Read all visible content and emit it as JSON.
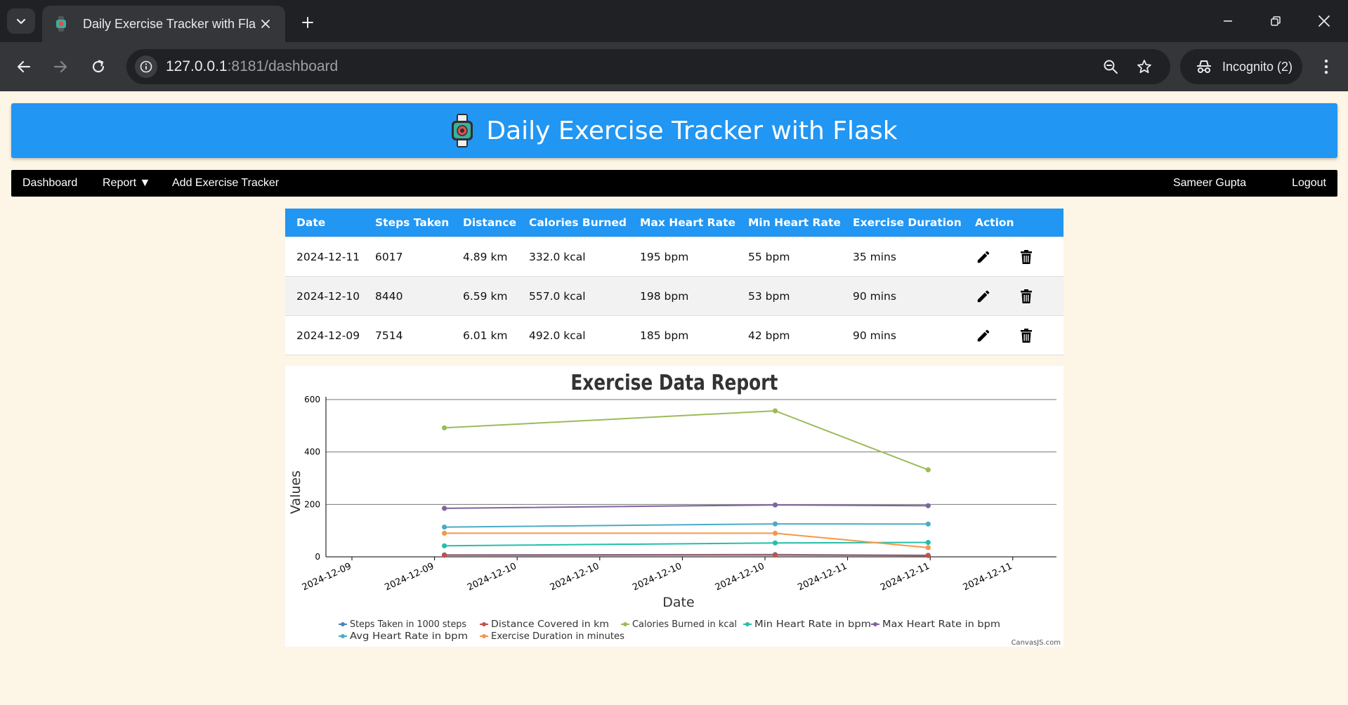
{
  "browser": {
    "tab_title": "Daily Exercise Tracker with Flask",
    "url_host": "127.0.0.1",
    "url_path": ":8181/dashboard",
    "incognito_label": "Incognito (2)"
  },
  "header": {
    "title": "Daily Exercise Tracker with Flask"
  },
  "nav": {
    "dashboard": "Dashboard",
    "report": "Report ▼",
    "add_tracker": "Add Exercise Tracker",
    "user": "Sameer Gupta",
    "logout": "Logout"
  },
  "table": {
    "headers": [
      "Date",
      "Steps Taken",
      "Distance",
      "Calories Burned",
      "Max Heart Rate",
      "Min Heart Rate",
      "Exercise Duration",
      "Action"
    ],
    "rows": [
      [
        "2024-12-11",
        "6017",
        "4.89 km",
        "332.0 kcal",
        "195 bpm",
        "55 bpm",
        "35 mins"
      ],
      [
        "2024-12-10",
        "8440",
        "6.59 km",
        "557.0 kcal",
        "198 bpm",
        "53 bpm",
        "90 mins"
      ],
      [
        "2024-12-09",
        "7514",
        "6.01 km",
        "492.0 kcal",
        "185 bpm",
        "42 bpm",
        "90 mins"
      ]
    ]
  },
  "colors": {
    "accent": "#2196f3",
    "navbar": "#000000",
    "page_bg": "#fdf5e6"
  },
  "chart_data": {
    "type": "line",
    "title": "Exercise Data Report",
    "xlabel": "Date",
    "ylabel": "Values",
    "ylim": [
      0,
      600
    ],
    "yticks": [
      0,
      200,
      400,
      600
    ],
    "xlim": [
      "2024-12-08 12:00",
      "2024-12-11 14:00"
    ],
    "x_tick_labels": [
      "2024-12-09",
      "2024-12-09",
      "2024-12-10",
      "2024-12-10",
      "2024-12-10",
      "2024-12-10",
      "2024-12-11",
      "2024-12-11",
      "2024-12-11"
    ],
    "x": [
      "2024-12-09 00:00",
      "2024-12-10 09:30",
      "2024-12-11 01:00"
    ],
    "grid": true,
    "legend_position": "bottom-center",
    "credit": "CanvasJS.com",
    "series": [
      {
        "name": "Steps Taken in 1000 steps",
        "color": "#4f81bc",
        "values": [
          7.514,
          8.44,
          6.017
        ]
      },
      {
        "name": "Distance Covered in km",
        "color": "#c0504e",
        "values": [
          6.01,
          6.59,
          4.89
        ]
      },
      {
        "name": "Calories Burned in kcal",
        "color": "#9bbb58",
        "values": [
          492,
          557,
          332
        ]
      },
      {
        "name": "Min Heart Rate in bpm",
        "color": "#23bfaa",
        "values": [
          42,
          53,
          55
        ]
      },
      {
        "name": "Max Heart Rate in bpm",
        "color": "#8064a1",
        "values": [
          185,
          198,
          195
        ]
      },
      {
        "name": "Avg Heart Rate in bpm",
        "color": "#4aacc5",
        "values": [
          113.5,
          125.5,
          125
        ]
      },
      {
        "name": "Exercise Duration in minutes",
        "color": "#f79647",
        "values": [
          90,
          90,
          35
        ]
      }
    ]
  }
}
